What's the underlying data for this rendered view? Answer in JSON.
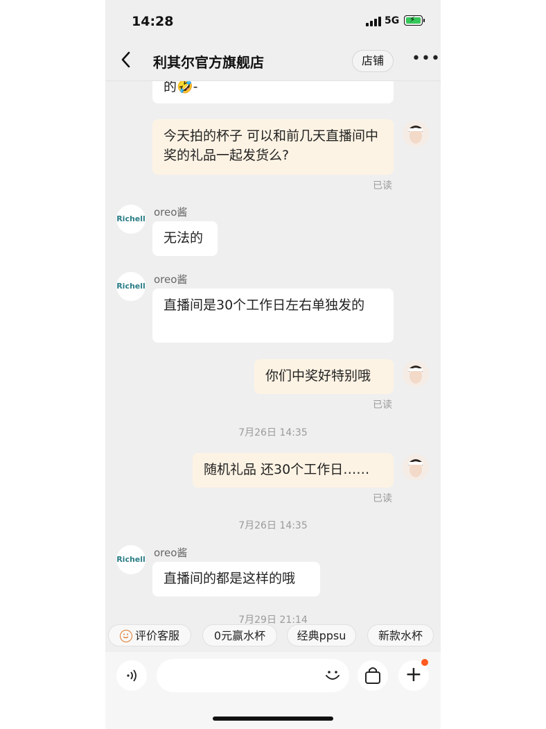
{
  "status": {
    "time": "14:28",
    "network": "5G"
  },
  "header": {
    "title": "利其尔官方旗舰店",
    "shop_button": "店铺"
  },
  "brand": {
    "logo_text": "Richell"
  },
  "messages": [
    {
      "side": "right",
      "text": "的🤣-"
    },
    {
      "side": "right",
      "text": "今天拍的杯子 可以和前几天直播间中奖的礼品一起发货么?",
      "status": "已读"
    },
    {
      "side": "left",
      "sender": "oreo酱",
      "text": "无法的"
    },
    {
      "side": "left",
      "sender": "oreo酱",
      "text": "直播间是30个工作日左右单独发的"
    },
    {
      "side": "right",
      "text": "你们中奖好特别哦",
      "status": "已读"
    },
    {
      "timestamp": "7月26日 14:35"
    },
    {
      "side": "right",
      "text": "随机礼品 还30个工作日……",
      "status": "已读"
    },
    {
      "timestamp": "7月26日 14:35"
    },
    {
      "side": "left",
      "sender": "oreo酱",
      "text": "直播间的都是这样的哦"
    },
    {
      "timestamp": "7月29日 21:14"
    }
  ],
  "quick_actions": [
    "评价客服",
    "0元赢水杯",
    "经典ppsu",
    "新款水杯"
  ],
  "colors": {
    "background": "#efefef",
    "bubble_right": "#fdf3e4",
    "bubble_left": "#ffffff",
    "notification_dot": "#ff5a1f"
  }
}
